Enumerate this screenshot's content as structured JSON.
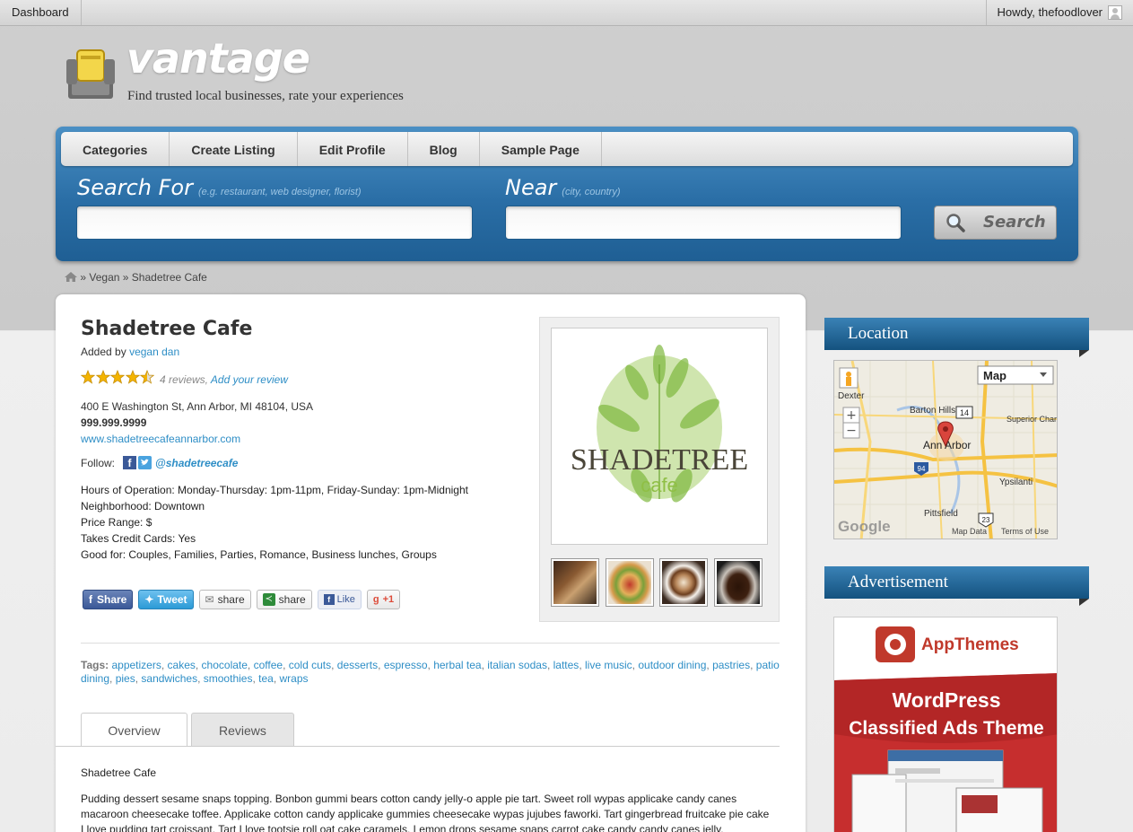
{
  "adminbar": {
    "dashboard": "Dashboard",
    "howdy": "Howdy, thefoodlover"
  },
  "site": {
    "name": "vantage",
    "tagline": "Find trusted local businesses, rate your experiences"
  },
  "nav": [
    "Categories",
    "Create Listing",
    "Edit Profile",
    "Blog",
    "Sample Page"
  ],
  "search": {
    "for_label": "Search For",
    "for_hint": "(e.g. restaurant, web designer, florist)",
    "near_label": "Near",
    "near_hint": "(city, country)",
    "button": "Search"
  },
  "breadcrumb": {
    "sep1": "»",
    "cat": "Vegan",
    "sep2": "»",
    "current": "Shadetree Cafe"
  },
  "listing": {
    "title": "Shadetree Cafe",
    "added_by_prefix": "Added by",
    "added_by": "vegan dan",
    "rating": 4.5,
    "reviews_count": "4 reviews,",
    "add_review": "Add your review",
    "address": "400 E Washington St, Ann Arbor, MI 48104, USA",
    "phone": "999.999.9999",
    "website": "www.shadetreecafeannarbor.com",
    "follow_label": "Follow:",
    "twitter_handle": "@shadetreecafe",
    "details": [
      "Hours of Operation: Monday-Thursday: 1pm-11pm, Friday-Sunday: 1pm-Midnight",
      "Neighborhood: Downtown",
      "Price Range: $",
      "Takes Credit Cards: Yes",
      "Good for: Couples, Families, Parties, Romance, Business lunches, Groups"
    ],
    "share": {
      "facebook": "Share",
      "tweet": "Tweet",
      "email": "share",
      "sharethis": "share",
      "like": "Like",
      "gplus": "+1"
    },
    "logo": {
      "line1": "SHADETREE",
      "line2": "cafe"
    },
    "tags_label": "Tags:",
    "tags": [
      "appetizers",
      "cakes",
      "chocolate",
      "coffee",
      "cold cuts",
      "desserts",
      "espresso",
      "herbal tea",
      "italian sodas",
      "lattes",
      "live music",
      "outdoor dining",
      "pastries",
      "patio dining",
      "pies",
      "sandwiches",
      "smoothies",
      "tea",
      "wraps"
    ],
    "tabs": [
      "Overview",
      "Reviews"
    ],
    "overview_title": "Shadetree Cafe",
    "overview_text": "Pudding dessert sesame snaps topping. Bonbon gummi bears cotton candy jelly-o apple pie tart. Sweet roll wypas applicake candy canes macaroon cheesecake toffee. Applicake cotton candy applicake gummies cheesecake wypas jujubes faworki. Tart gingerbread fruitcake pie cake I love pudding tart croissant. Tart I love tootsie roll oat cake caramels. Lemon drops sesame snaps carrot cake candy candy canes jelly."
  },
  "sidebar": {
    "location_title": "Location",
    "map": {
      "type_select": "Map",
      "places": [
        "Barton Hills",
        "Ann Arbor",
        "Superior Charter Township",
        "Ypsilanti",
        "Pittsfield",
        "Dexter"
      ],
      "route_labels": [
        "14",
        "94",
        "23"
      ],
      "zoom_in": "+",
      "zoom_out": "−",
      "logo": "Google",
      "data": "Map Data",
      "terms": "Terms of Use"
    },
    "ad_title": "Advertisement",
    "ad": {
      "brand": "AppThemes",
      "line1": "WordPress",
      "line2": "Classified Ads Theme"
    }
  },
  "colors": {
    "accent": "#2e8ec6",
    "header_blue": "#1f5f94"
  }
}
